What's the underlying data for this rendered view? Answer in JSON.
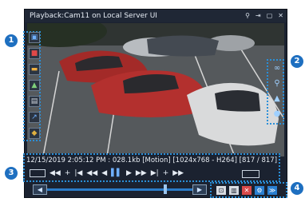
{
  "window": {
    "title": "Playback:Cam11 on Local Server UI",
    "title_icons": [
      "pin-icon",
      "export-icon",
      "maximize-icon",
      "close-icon",
      "pause-small-icon"
    ]
  },
  "callouts": [
    "1",
    "2",
    "3",
    "4"
  ],
  "status": {
    "text": "12/15/2019 2:05:12 PM : 028.1kb [Motion] [1024x768 - H264] [817 / 817]"
  },
  "left_toolbar": [
    {
      "name": "camera-select-icon",
      "glyph": "▣",
      "color": "#6fb0ff"
    },
    {
      "name": "stop-record-icon",
      "glyph": "■",
      "color": "#e04848"
    },
    {
      "name": "folder-icon",
      "glyph": "▬",
      "color": "#f0b040"
    },
    {
      "name": "image-icon",
      "glyph": "▲",
      "color": "#7fd07a"
    },
    {
      "name": "print-icon",
      "glyph": "▤",
      "color": "#d0d6dd"
    },
    {
      "name": "popout-icon",
      "glyph": "↗",
      "color": "#6fb0ff"
    },
    {
      "name": "tag-icon",
      "glyph": "◆",
      "color": "#e0b040"
    }
  ],
  "right_toolbar": [
    {
      "name": "binoculars-icon",
      "glyph": "∞"
    },
    {
      "name": "zoom-icon",
      "glyph": "⚲"
    },
    {
      "name": "picture-icon",
      "glyph": "▲"
    },
    {
      "name": "microphone-icon",
      "glyph": "●"
    }
  ],
  "controls": [
    "◀◀",
    "+",
    "|◀",
    "◀◀",
    "◀",
    "▌▌",
    "▶",
    "▶▶",
    "▶|",
    "+",
    "▶▶"
  ],
  "bottom_icons": [
    {
      "name": "frame-icon",
      "glyph": "⊡",
      "bg": "#d9dde3",
      "color": "#1b2230"
    },
    {
      "name": "grid-icon",
      "glyph": "▥",
      "bg": "#d9dde3",
      "color": "#1b2230"
    },
    {
      "name": "bookmark-icon",
      "glyph": "✕",
      "bg": "#d94a4a",
      "color": "#ffffff"
    },
    {
      "name": "settings-icon",
      "glyph": "⚙",
      "bg": "#2a7fd0",
      "color": "#ffffff"
    },
    {
      "name": "forward-icon",
      "glyph": "≫",
      "bg": "#2a7fd0",
      "color": "#ffffff"
    }
  ]
}
